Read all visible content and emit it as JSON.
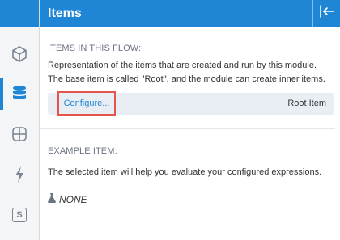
{
  "header": {
    "title": "Items"
  },
  "sidebar": {
    "icons": [
      "cube-icon",
      "database-icon",
      "grid-icon",
      "lightning-icon",
      "s-badge-icon"
    ],
    "badge_letter": "S",
    "active_index": 1
  },
  "items_section": {
    "label": "ITEMS IN THIS FLOW:",
    "description": "Representation of the items that are created and run by this module. The base item is called \"Root\", and the module can create inner items.",
    "configure_label": "Configure...",
    "root_item_label": "Root Item"
  },
  "example_section": {
    "label": "EXAMPLE ITEM:",
    "description": "The selected item will help you evaluate your configured expressions.",
    "value": "NONE",
    "value_icon": "flask-icon"
  },
  "colors": {
    "accent": "#1e86d4",
    "highlight": "#e4554b",
    "row_bg": "#e9eef5"
  }
}
